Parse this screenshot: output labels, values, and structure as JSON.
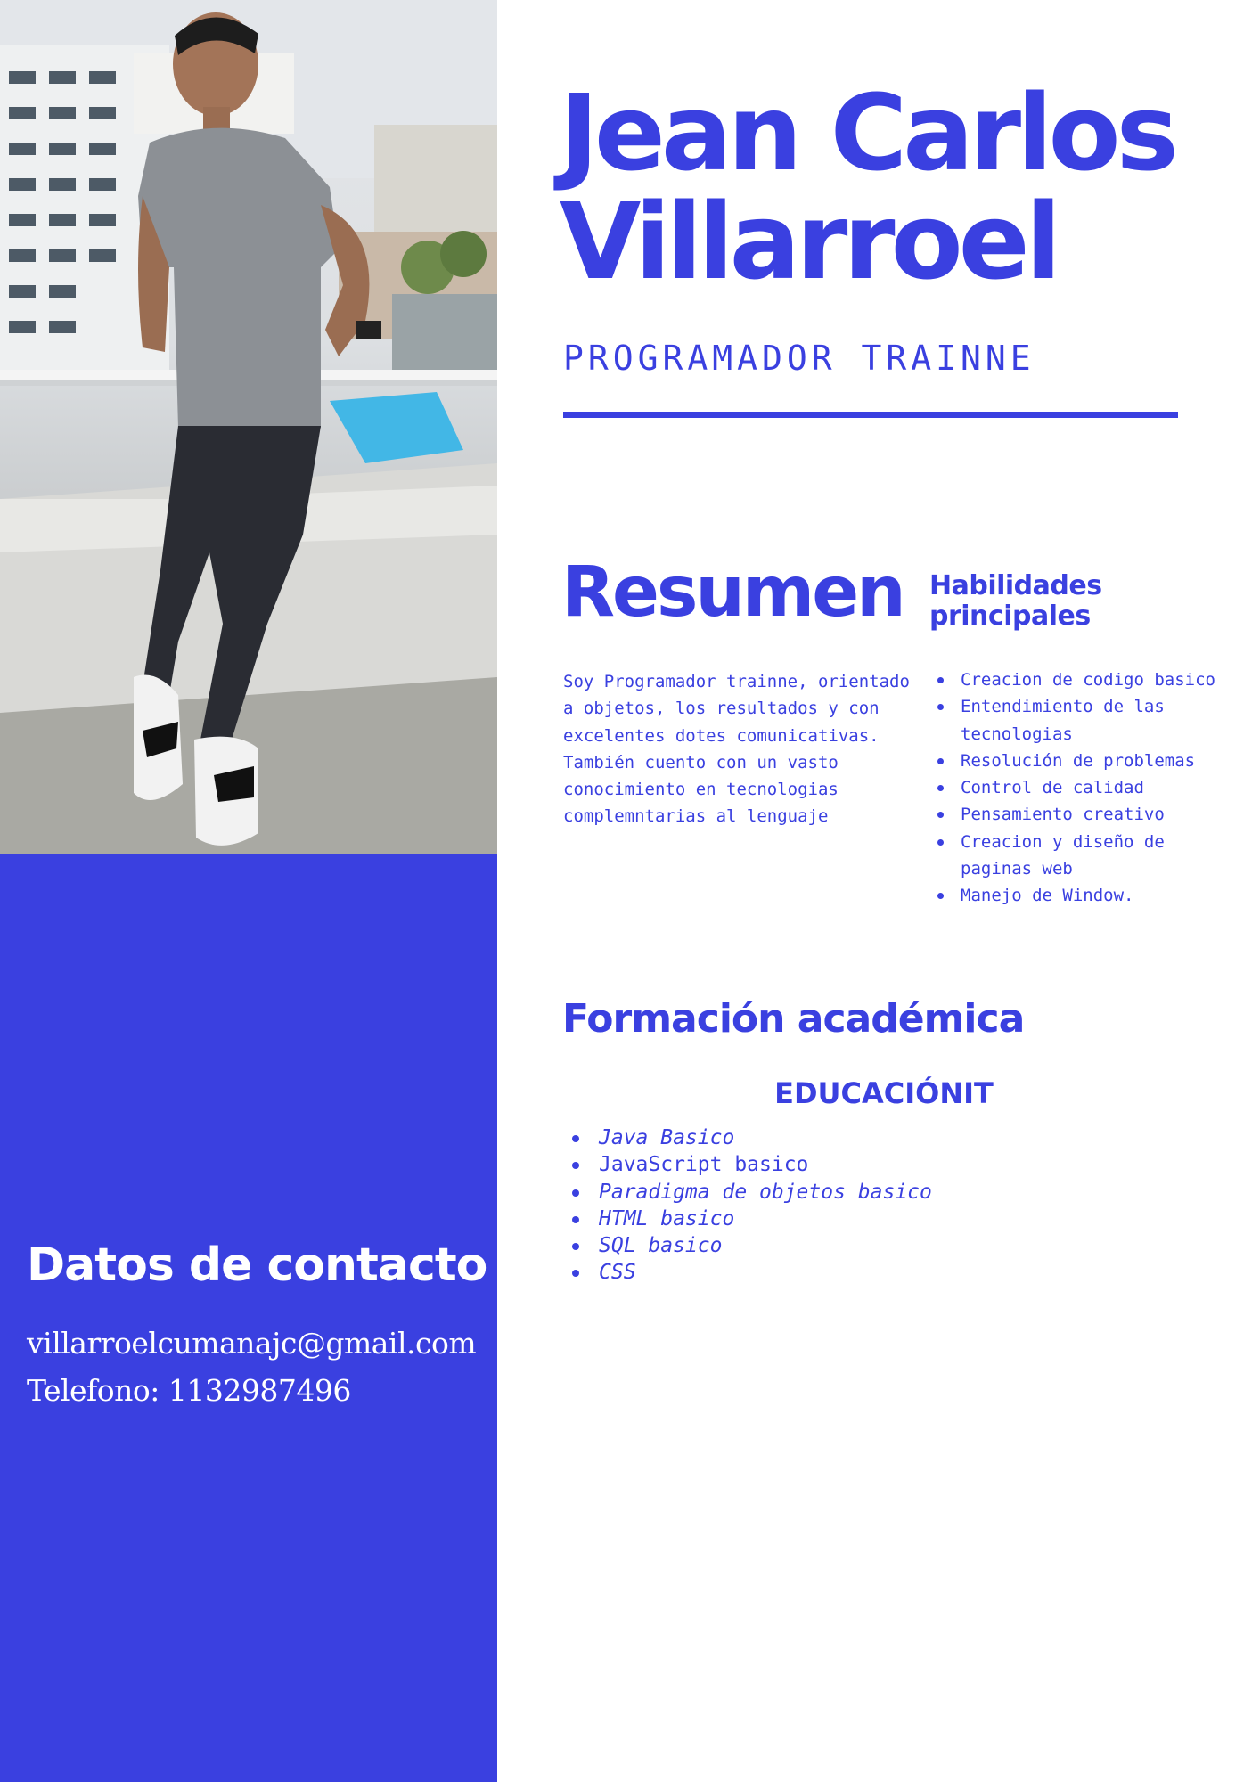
{
  "header": {
    "name_line1": "Jean Carlos",
    "name_line2": "Villarroel",
    "role": "PROGRAMADOR TRAINNE"
  },
  "summary": {
    "title": "Resumen",
    "text": "Soy Programador trainne, orientado a objetos, los resultados y con excelentes dotes comunicativas. También cuento con un vasto conocimiento en tecnologias complemntarias al lenguaje"
  },
  "skills": {
    "title": "Habilidades principales",
    "items": [
      "Creacion de codigo basico",
      "Entendimiento de las tecnologias",
      "Resolución de problemas",
      "Control de calidad",
      "Pensamiento creativo",
      "Creacion y diseño de paginas web",
      "Manejo de Window."
    ]
  },
  "education": {
    "title": "Formación académica",
    "school": "EDUCACIÓNIT",
    "courses": [
      {
        "label": "Java Basico",
        "italic": true
      },
      {
        "label": "JavaScript basico",
        "italic": false
      },
      {
        "label": "Paradigma de objetos basico",
        "italic": true
      },
      {
        "label": "HTML basico",
        "italic": true
      },
      {
        "label": "SQL basico",
        "italic": true
      },
      {
        "label": "CSS",
        "italic": true
      }
    ]
  },
  "contact": {
    "title": "Datos de contacto",
    "email": "villarroelcumanajc@gmail.com",
    "phone": "Telefono: 1132987496"
  },
  "colors": {
    "accent": "#3a40e0",
    "sidebar_text": "#ffffff"
  }
}
